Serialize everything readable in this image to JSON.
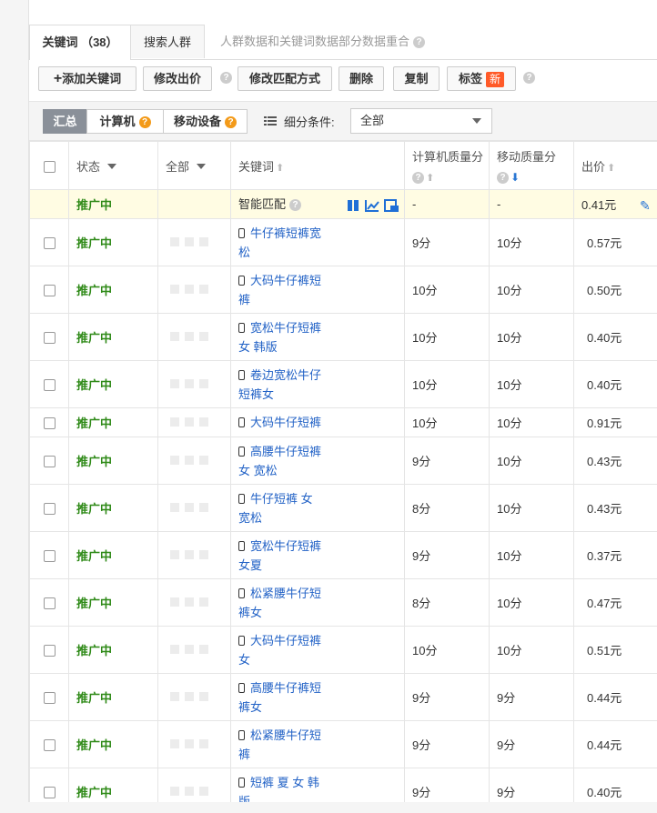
{
  "tabs": {
    "keywords": "关键词 （38）",
    "audience": "搜索人群",
    "note": "人群数据和关键词数据部分数据重合"
  },
  "toolbar": {
    "add_keyword": "添加关键词",
    "edit_bid": "修改出价",
    "edit_match": "修改匹配方式",
    "delete": "删除",
    "copy": "复制",
    "tag": "标签",
    "tag_badge": "新"
  },
  "filters": {
    "summary": "汇总",
    "computer": "计算机",
    "mobile": "移动设备",
    "segment_label": "细分条件:",
    "segment_value": "全部"
  },
  "columns": {
    "status": "状态",
    "all": "全部",
    "keyword": "关键词",
    "pc_quality": "计算机质量分",
    "mobile_quality": "移动质量分",
    "bid": "出价"
  },
  "smart_row": {
    "status": "推广中",
    "keyword": "智能匹配",
    "pc_quality": "-",
    "mobile_quality": "-",
    "bid": "0.41元"
  },
  "rows": [
    {
      "status": "推广中",
      "keyword_l1": "牛仔裤短裤宽",
      "keyword_l2": "松",
      "pc": "9分",
      "mobile": "10分",
      "bid": "0.57元"
    },
    {
      "status": "推广中",
      "keyword_l1": "大码牛仔裤短",
      "keyword_l2": "裤",
      "pc": "10分",
      "mobile": "10分",
      "bid": "0.50元"
    },
    {
      "status": "推广中",
      "keyword_l1": "宽松牛仔短裤",
      "keyword_l2": "女 韩版",
      "pc": "10分",
      "mobile": "10分",
      "bid": "0.40元"
    },
    {
      "status": "推广中",
      "keyword_l1": "卷边宽松牛仔",
      "keyword_l2": "短裤女",
      "pc": "10分",
      "mobile": "10分",
      "bid": "0.40元"
    },
    {
      "status": "推广中",
      "keyword_l1": "大码牛仔短裤",
      "keyword_l2": "",
      "pc": "10分",
      "mobile": "10分",
      "bid": "0.91元"
    },
    {
      "status": "推广中",
      "keyword_l1": "高腰牛仔短裤",
      "keyword_l2": "女 宽松",
      "pc": "9分",
      "mobile": "10分",
      "bid": "0.43元"
    },
    {
      "status": "推广中",
      "keyword_l1": "牛仔短裤 女",
      "keyword_l2": "宽松",
      "pc": "8分",
      "mobile": "10分",
      "bid": "0.43元"
    },
    {
      "status": "推广中",
      "keyword_l1": "宽松牛仔短裤",
      "keyword_l2": "女夏",
      "pc": "9分",
      "mobile": "10分",
      "bid": "0.37元"
    },
    {
      "status": "推广中",
      "keyword_l1": "松紧腰牛仔短",
      "keyword_l2": "裤女",
      "pc": "8分",
      "mobile": "10分",
      "bid": "0.47元"
    },
    {
      "status": "推广中",
      "keyword_l1": "大码牛仔短裤",
      "keyword_l2": "女",
      "pc": "10分",
      "mobile": "10分",
      "bid": "0.51元"
    },
    {
      "status": "推广中",
      "keyword_l1": "高腰牛仔裤短",
      "keyword_l2": "裤女",
      "pc": "9分",
      "mobile": "9分",
      "bid": "0.44元"
    },
    {
      "status": "推广中",
      "keyword_l1": "松紧腰牛仔短",
      "keyword_l2": "裤",
      "pc": "9分",
      "mobile": "9分",
      "bid": "0.44元"
    },
    {
      "status": "推广中",
      "keyword_l1": "短裤 夏 女 韩",
      "keyword_l2": "版",
      "pc": "9分",
      "mobile": "9分",
      "bid": "0.40元"
    }
  ]
}
